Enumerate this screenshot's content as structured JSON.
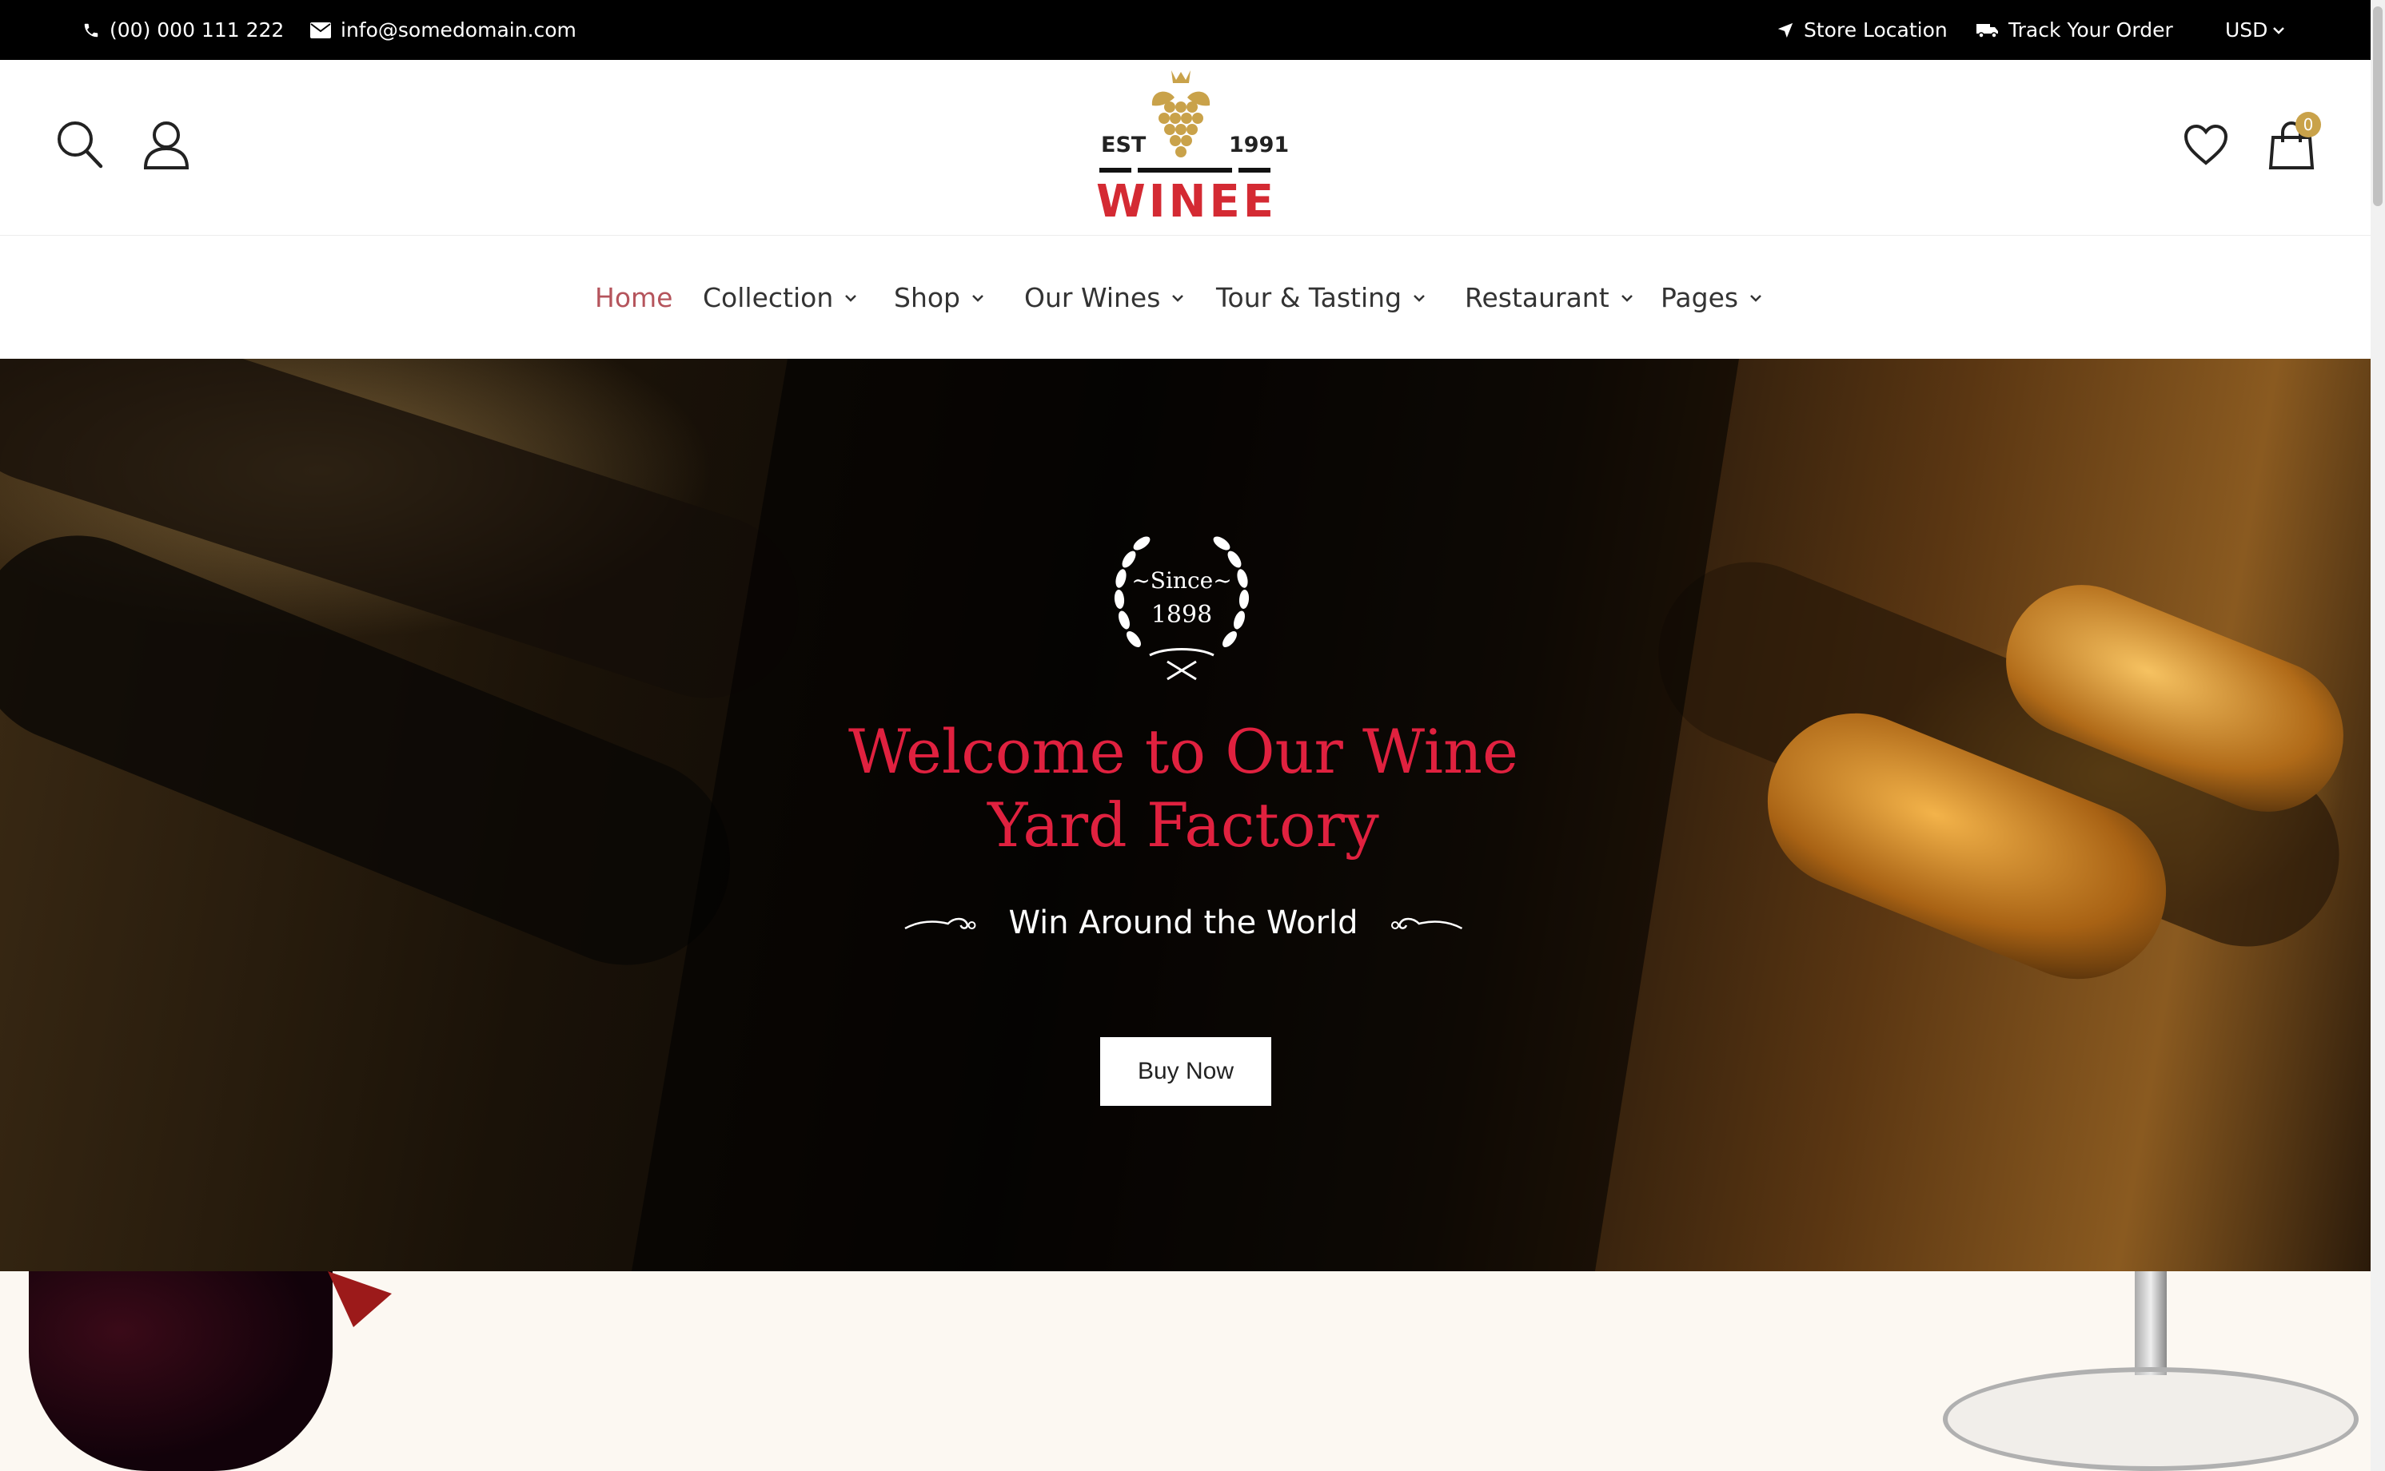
{
  "topbar": {
    "phone": "(00) 000 111 222",
    "email": "info@somedomain.com",
    "store_location": "Store Location",
    "track_order": "Track Your Order",
    "currency": "USD"
  },
  "header": {
    "logo": {
      "est": "EST",
      "year": "1991",
      "brand": "WINEE"
    },
    "cart_count": "0"
  },
  "nav": {
    "items": [
      {
        "label": "Home",
        "active": true
      },
      {
        "label": "Collection"
      },
      {
        "label": "Shop"
      },
      {
        "label": "Our Wines"
      },
      {
        "label": "Tour & Tasting"
      },
      {
        "label": "Restaurant"
      },
      {
        "label": "Pages"
      }
    ]
  },
  "hero": {
    "badge_since": "~Since~",
    "badge_year": "1898",
    "title_line1": "Welcome to Our Wine",
    "title_line2": "Yard Factory",
    "subtitle": "Win Around the World",
    "button": "Buy Now"
  },
  "colors": {
    "accent_red": "#e0213f",
    "nav_active": "#b5545c",
    "gold": "#c9a24a"
  }
}
